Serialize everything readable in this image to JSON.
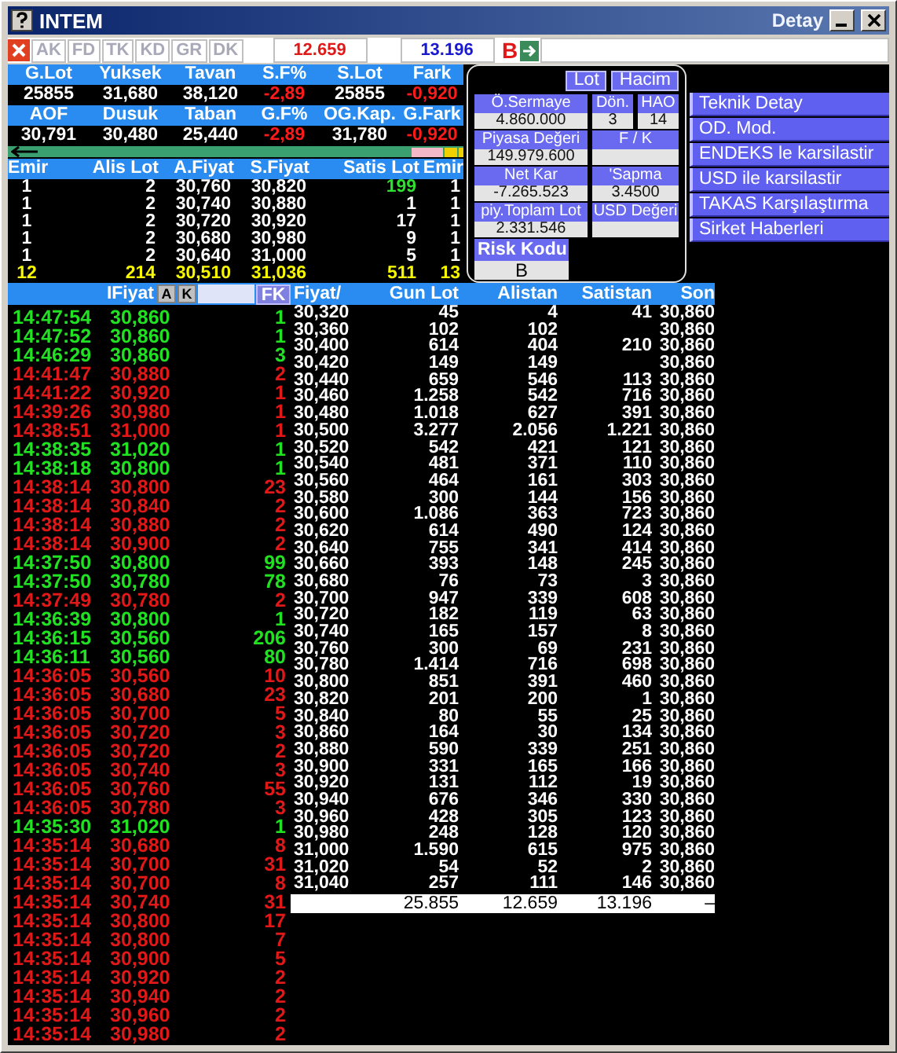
{
  "window": {
    "title": "INTEM",
    "subtitle": "Detay"
  },
  "toolbar": {
    "tabs": [
      {
        "label": "AK",
        "disabled": true
      },
      {
        "label": "FD",
        "disabled": true
      },
      {
        "label": "TK",
        "disabled": true
      },
      {
        "label": "KD",
        "disabled": true
      },
      {
        "label": "GR",
        "disabled": true
      },
      {
        "label": "DK",
        "disabled": true
      }
    ],
    "bid_total": "12.659",
    "ask_total": "13.196",
    "badge": "B"
  },
  "summary": [
    {
      "labels": [
        "G.Lot",
        "Yuksek",
        "Tavan",
        "S.F%",
        "S.Lot",
        "Fark"
      ],
      "values": [
        {
          "text": "25855",
          "negative": false
        },
        {
          "text": "31,680",
          "negative": false
        },
        {
          "text": "38,120",
          "negative": false
        },
        {
          "text": "-2,89",
          "negative": true
        },
        {
          "text": "25855",
          "negative": false
        },
        {
          "text": "-0,920",
          "negative": true
        }
      ]
    },
    {
      "labels": [
        "AOF",
        "Dusuk",
        "Taban",
        "G.F%",
        "OG.Kap.",
        "G.Fark"
      ],
      "values": [
        {
          "text": "30,791",
          "negative": false
        },
        {
          "text": "30,480",
          "negative": false
        },
        {
          "text": "25,440",
          "negative": false
        },
        {
          "text": "-2,89",
          "negative": true
        },
        {
          "text": "31,780",
          "negative": false
        },
        {
          "text": "-0,920",
          "negative": true
        }
      ]
    }
  ],
  "depth": {
    "columns": [
      "Emir",
      "Alis Lot",
      "A.Fiyat",
      "S.Fiyat",
      "Satis Lot",
      "Emir"
    ],
    "rows": [
      {
        "cells": [
          "1",
          "2",
          "30,760",
          "30,820",
          "199",
          "1"
        ],
        "changed": true
      },
      {
        "cells": [
          "1",
          "2",
          "30,740",
          "30,880",
          "1",
          "1"
        ],
        "changed": false
      },
      {
        "cells": [
          "1",
          "2",
          "30,720",
          "30,920",
          "17",
          "1"
        ],
        "changed": false
      },
      {
        "cells": [
          "1",
          "2",
          "30,680",
          "30,980",
          "9",
          "1"
        ],
        "changed": false
      },
      {
        "cells": [
          "1",
          "2",
          "30,640",
          "31,000",
          "5",
          "1"
        ],
        "changed": false
      }
    ],
    "totals": [
      "12",
      "214",
      "30,510",
      "31,036",
      "511",
      "13"
    ]
  },
  "detail": {
    "toggles": [
      "Lot",
      "Hacim"
    ],
    "rows": [
      [
        {
          "label": "Ö.Sermaye",
          "value": "4.860.000"
        },
        {
          "label": "Dön.",
          "value": "3"
        },
        {
          "label": "HAO",
          "value": "14"
        }
      ],
      [
        {
          "label": "Piyasa Değeri",
          "value": "149.979.600"
        },
        {
          "label": "F / K"
        }
      ],
      [
        {
          "label": "Net Kar",
          "value": "-7.265.523"
        },
        {
          "label": "'Sapma",
          "value": "3.4500"
        }
      ],
      [
        {
          "label": "piy.Toplam Lot",
          "value": "2.331.546"
        },
        {
          "label": "USD Değeri"
        }
      ]
    ],
    "risk": {
      "label": "Risk Kodu",
      "value": "B"
    }
  },
  "menu": [
    "Teknik Detay",
    "OD. Mod.",
    "ENDEKS le karsilastir",
    "USD ile karsilastir",
    "TAKAS Karşılaştırma",
    "Sirket Haberleri"
  ],
  "trades": {
    "title": "IFiyat",
    "buttons": [
      "A",
      "K"
    ],
    "filter_button": "FK",
    "rows": [
      {
        "time": "14:47:54",
        "price": "30,860",
        "lot": "1",
        "color": "#22e022"
      },
      {
        "time": "14:47:52",
        "price": "30,860",
        "lot": "1",
        "color": "#22e022"
      },
      {
        "time": "14:46:29",
        "price": "30,860",
        "lot": "3",
        "color": "#22e022"
      },
      {
        "time": "14:41:47",
        "price": "30,880",
        "lot": "2",
        "color": "#e01818"
      },
      {
        "time": "14:41:22",
        "price": "30,920",
        "lot": "1",
        "color": "#e01818"
      },
      {
        "time": "14:39:26",
        "price": "30,980",
        "lot": "1",
        "color": "#e01818"
      },
      {
        "time": "14:38:51",
        "price": "31,000",
        "lot": "1",
        "color": "#e01818"
      },
      {
        "time": "14:38:35",
        "price": "31,020",
        "lot": "1",
        "color": "#22e022"
      },
      {
        "time": "14:38:18",
        "price": "30,800",
        "lot": "1",
        "color": "#22e022"
      },
      {
        "time": "14:38:14",
        "price": "30,800",
        "lot": "23",
        "color": "#e01818"
      },
      {
        "time": "14:38:14",
        "price": "30,840",
        "lot": "2",
        "color": "#e01818"
      },
      {
        "time": "14:38:14",
        "price": "30,880",
        "lot": "2",
        "color": "#e01818"
      },
      {
        "time": "14:38:14",
        "price": "30,900",
        "lot": "2",
        "color": "#e01818"
      },
      {
        "time": "14:37:50",
        "price": "30,800",
        "lot": "99",
        "color": "#22e022"
      },
      {
        "time": "14:37:50",
        "price": "30,780",
        "lot": "78",
        "color": "#22e022"
      },
      {
        "time": "14:37:49",
        "price": "30,780",
        "lot": "2",
        "color": "#e01818"
      },
      {
        "time": "14:36:39",
        "price": "30,800",
        "lot": "1",
        "color": "#22e022"
      },
      {
        "time": "14:36:15",
        "price": "30,560",
        "lot": "206",
        "color": "#22e022"
      },
      {
        "time": "14:36:11",
        "price": "30,560",
        "lot": "80",
        "color": "#22e022"
      },
      {
        "time": "14:36:05",
        "price": "30,560",
        "lot": "10",
        "color": "#e01818"
      },
      {
        "time": "14:36:05",
        "price": "30,680",
        "lot": "23",
        "color": "#e01818"
      },
      {
        "time": "14:36:05",
        "price": "30,700",
        "lot": "5",
        "color": "#e01818"
      },
      {
        "time": "14:36:05",
        "price": "30,720",
        "lot": "3",
        "color": "#e01818"
      },
      {
        "time": "14:36:05",
        "price": "30,720",
        "lot": "2",
        "color": "#e01818"
      },
      {
        "time": "14:36:05",
        "price": "30,740",
        "lot": "3",
        "color": "#e01818"
      },
      {
        "time": "14:36:05",
        "price": "30,760",
        "lot": "55",
        "color": "#e01818"
      },
      {
        "time": "14:36:05",
        "price": "30,780",
        "lot": "3",
        "color": "#e01818"
      },
      {
        "time": "14:35:30",
        "price": "31,020",
        "lot": "1",
        "color": "#22e022"
      },
      {
        "time": "14:35:14",
        "price": "30,680",
        "lot": "8",
        "color": "#e01818"
      },
      {
        "time": "14:35:14",
        "price": "30,700",
        "lot": "31",
        "color": "#e01818"
      },
      {
        "time": "14:35:14",
        "price": "30,700",
        "lot": "8",
        "color": "#e01818"
      },
      {
        "time": "14:35:14",
        "price": "30,740",
        "lot": "31",
        "color": "#e01818"
      },
      {
        "time": "14:35:14",
        "price": "30,800",
        "lot": "17",
        "color": "#e01818"
      },
      {
        "time": "14:35:14",
        "price": "30,800",
        "lot": "7",
        "color": "#e01818"
      },
      {
        "time": "14:35:14",
        "price": "30,900",
        "lot": "5",
        "color": "#e01818"
      },
      {
        "time": "14:35:14",
        "price": "30,920",
        "lot": "2",
        "color": "#e01818"
      },
      {
        "time": "14:35:14",
        "price": "30,940",
        "lot": "2",
        "color": "#e01818"
      },
      {
        "time": "14:35:14",
        "price": "30,960",
        "lot": "2",
        "color": "#e01818"
      },
      {
        "time": "14:35:14",
        "price": "30,980",
        "lot": "2",
        "color": "#e01818"
      }
    ]
  },
  "price_table": {
    "columns": [
      "Fiyat/",
      "Gun Lot",
      "Alistan",
      "Satistan",
      "Son"
    ],
    "rows": [
      {
        "price": "30,320",
        "gun_lot": "45",
        "alistan": "4",
        "satistan": "41",
        "son": "30,860"
      },
      {
        "price": "30,360",
        "gun_lot": "102",
        "alistan": "102",
        "son": "30,860"
      },
      {
        "price": "30,400",
        "gun_lot": "614",
        "alistan": "404",
        "satistan": "210",
        "son": "30,860"
      },
      {
        "price": "30,420",
        "gun_lot": "149",
        "alistan": "149",
        "son": "30,860"
      },
      {
        "price": "30,440",
        "gun_lot": "659",
        "alistan": "546",
        "satistan": "113",
        "son": "30,860"
      },
      {
        "price": "30,460",
        "gun_lot": "1.258",
        "alistan": "542",
        "satistan": "716",
        "son": "30,860"
      },
      {
        "price": "30,480",
        "gun_lot": "1.018",
        "alistan": "627",
        "satistan": "391",
        "son": "30,860"
      },
      {
        "price": "30,500",
        "gun_lot": "3.277",
        "alistan": "2.056",
        "satistan": "1.221",
        "son": "30,860"
      },
      {
        "price": "30,520",
        "gun_lot": "542",
        "alistan": "421",
        "satistan": "121",
        "son": "30,860"
      },
      {
        "price": "30,540",
        "gun_lot": "481",
        "alistan": "371",
        "satistan": "110",
        "son": "30,860"
      },
      {
        "price": "30,560",
        "gun_lot": "464",
        "alistan": "161",
        "satistan": "303",
        "son": "30,860"
      },
      {
        "price": "30,580",
        "gun_lot": "300",
        "alistan": "144",
        "satistan": "156",
        "son": "30,860"
      },
      {
        "price": "30,600",
        "gun_lot": "1.086",
        "alistan": "363",
        "satistan": "723",
        "son": "30,860"
      },
      {
        "price": "30,620",
        "gun_lot": "614",
        "alistan": "490",
        "satistan": "124",
        "son": "30,860"
      },
      {
        "price": "30,640",
        "gun_lot": "755",
        "alistan": "341",
        "satistan": "414",
        "son": "30,860"
      },
      {
        "price": "30,660",
        "gun_lot": "393",
        "alistan": "148",
        "satistan": "245",
        "son": "30,860"
      },
      {
        "price": "30,680",
        "gun_lot": "76",
        "alistan": "73",
        "satistan": "3",
        "son": "30,860"
      },
      {
        "price": "30,700",
        "gun_lot": "947",
        "alistan": "339",
        "satistan": "608",
        "son": "30,860"
      },
      {
        "price": "30,720",
        "gun_lot": "182",
        "alistan": "119",
        "satistan": "63",
        "son": "30,860"
      },
      {
        "price": "30,740",
        "gun_lot": "165",
        "alistan": "157",
        "satistan": "8",
        "son": "30,860"
      },
      {
        "price": "30,760",
        "gun_lot": "300",
        "alistan": "69",
        "satistan": "231",
        "son": "30,860"
      },
      {
        "price": "30,780",
        "gun_lot": "1.414",
        "alistan": "716",
        "satistan": "698",
        "son": "30,860"
      },
      {
        "price": "30,800",
        "gun_lot": "851",
        "alistan": "391",
        "satistan": "460",
        "son": "30,860"
      },
      {
        "price": "30,820",
        "gun_lot": "201",
        "alistan": "200",
        "satistan": "1",
        "son": "30,860"
      },
      {
        "price": "30,840",
        "gun_lot": "80",
        "alistan": "55",
        "satistan": "25",
        "son": "30,860"
      },
      {
        "price": "30,860",
        "gun_lot": "164",
        "alistan": "30",
        "satistan": "134",
        "son": "30,860"
      },
      {
        "price": "30,880",
        "gun_lot": "590",
        "alistan": "339",
        "satistan": "251",
        "son": "30,860"
      },
      {
        "price": "30,900",
        "gun_lot": "331",
        "alistan": "165",
        "satistan": "166",
        "son": "30,860"
      },
      {
        "price": "30,920",
        "gun_lot": "131",
        "alistan": "112",
        "satistan": "19",
        "son": "30,860"
      },
      {
        "price": "30,940",
        "gun_lot": "676",
        "alistan": "346",
        "satistan": "330",
        "son": "30,860"
      },
      {
        "price": "30,960",
        "gun_lot": "428",
        "alistan": "305",
        "satistan": "123",
        "son": "30,860"
      },
      {
        "price": "30,980",
        "gun_lot": "248",
        "alistan": "128",
        "satistan": "120",
        "son": "30,860"
      },
      {
        "price": "31,000",
        "gun_lot": "1.590",
        "alistan": "615",
        "satistan": "975",
        "son": "30,860"
      },
      {
        "price": "31,020",
        "gun_lot": "54",
        "alistan": "52",
        "satistan": "2",
        "son": "30,860"
      },
      {
        "price": "31,040",
        "gun_lot": "257",
        "alistan": "111",
        "satistan": "146",
        "son": "30,860"
      }
    ],
    "totals": {
      "gun_lot": "25.855",
      "alistan": "12.659",
      "satistan": "13.196",
      "son": "–"
    }
  }
}
